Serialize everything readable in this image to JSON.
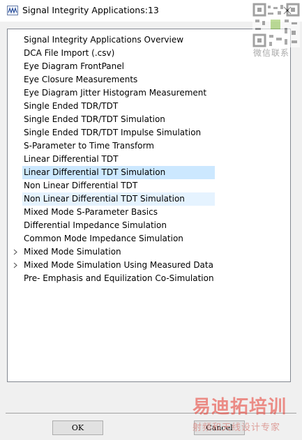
{
  "window": {
    "title": "Signal Integrity Applications:13",
    "app_icon": "waveform-icon",
    "close_icon": "close-icon"
  },
  "tree": {
    "items": [
      {
        "label": "Signal Integrity Applications Overview",
        "expandable": false,
        "state": "normal"
      },
      {
        "label": "DCA File Import (.csv)",
        "expandable": false,
        "state": "normal"
      },
      {
        "label": "Eye Diagram FrontPanel",
        "expandable": false,
        "state": "normal"
      },
      {
        "label": "Eye Closure Measurements",
        "expandable": false,
        "state": "normal"
      },
      {
        "label": "Eye Diagram Jitter Histogram Measurement",
        "expandable": false,
        "state": "normal"
      },
      {
        "label": "Single Ended TDR/TDT",
        "expandable": false,
        "state": "normal"
      },
      {
        "label": "Single Ended TDR/TDT Simulation",
        "expandable": false,
        "state": "normal"
      },
      {
        "label": "Single Ended TDR/TDT Impulse Simulation",
        "expandable": false,
        "state": "normal"
      },
      {
        "label": "S-Parameter to Time Transform",
        "expandable": false,
        "state": "normal"
      },
      {
        "label": "Linear Differential TDT",
        "expandable": false,
        "state": "normal"
      },
      {
        "label": "Linear Differential TDT Simulation",
        "expandable": false,
        "state": "selected"
      },
      {
        "label": "Non Linear Differential TDT",
        "expandable": false,
        "state": "normal"
      },
      {
        "label": "Non Linear Differential TDT Simulation",
        "expandable": false,
        "state": "hovered"
      },
      {
        "label": "Mixed Mode S-Parameter Basics",
        "expandable": false,
        "state": "normal"
      },
      {
        "label": "Differential Impedance Simulation",
        "expandable": false,
        "state": "normal"
      },
      {
        "label": "Common Mode Impedance Simulation",
        "expandable": false,
        "state": "normal"
      },
      {
        "label": "Mixed Mode Simulation",
        "expandable": true,
        "state": "normal"
      },
      {
        "label": "Mixed Mode Simulation Using Measured Data",
        "expandable": true,
        "state": "normal"
      },
      {
        "label": "Pre- Emphasis and Equilization Co-Simulation",
        "expandable": false,
        "state": "normal"
      }
    ]
  },
  "buttons": {
    "ok_label": "OK",
    "cancel_label": "Cancel"
  },
  "watermark": {
    "qr_caption": "微信联系",
    "brand": "易迪拓培训",
    "tagline": "射频和天线设计专家"
  },
  "colors": {
    "selected_row": "#cce8ff",
    "hovered_row": "#e5f3ff",
    "dialog_background": "#f0f0f0",
    "watermark_red": "#e8392e"
  }
}
